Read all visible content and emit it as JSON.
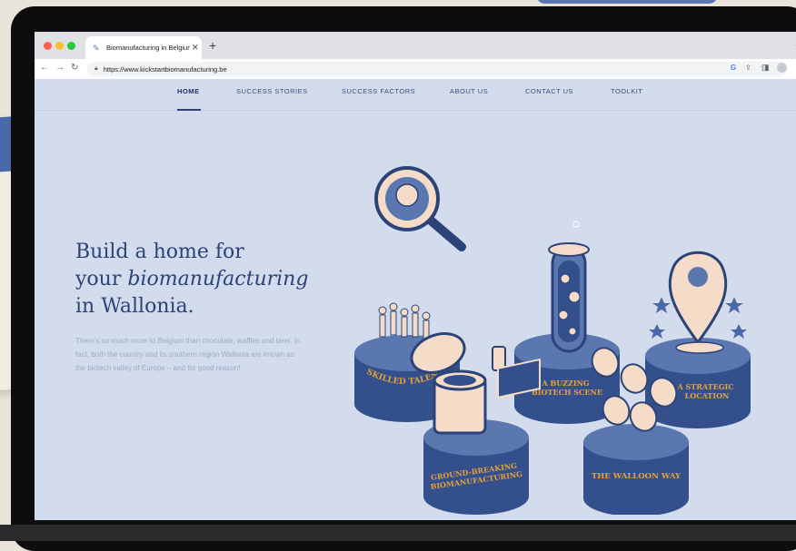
{
  "browser": {
    "tab_title": "Biomanufacturing in Belgium",
    "url": "https://www.kickstartbiomanufacturing.be"
  },
  "nav": {
    "items": [
      {
        "label": "HOME",
        "active": true
      },
      {
        "label": "SUCCESS STORIES",
        "active": false
      },
      {
        "label": "SUCCESS FACTORS",
        "active": false
      },
      {
        "label": "ABOUT US",
        "active": false
      },
      {
        "label": "CONTACT US",
        "active": false
      },
      {
        "label": "TOOLKIT",
        "active": false
      }
    ]
  },
  "hero": {
    "title_line1": "Build a home for",
    "title_line2_plain": "your ",
    "title_line2_em": "biomanufacturing",
    "title_line3": "in Wallonia.",
    "body": "There's so much more to Belgium than chocolate, waffles and beer. In fact, both the country and its southern region Wallonia are known as the biotech valley of Europe – and for good reason!"
  },
  "pillars": [
    {
      "label_line1": "SKILLED TALENT",
      "label_line2": ""
    },
    {
      "label_line1": "A BUZZING",
      "label_line2": "BIOTECH SCENE"
    },
    {
      "label_line1": "A STRATEGIC",
      "label_line2": "LOCATION"
    },
    {
      "label_line1": "GROUND-BREAKING",
      "label_line2": "BIOMANUFACTURING"
    },
    {
      "label_line1": "THE WALLOON WAY",
      "label_line2": ""
    }
  ],
  "colors": {
    "site_bg": "#d3dcec",
    "navy": "#2c4378",
    "pillar_top": "#5a77b0",
    "pillar_side": "#34508c",
    "gold": "#e6a13a",
    "cream": "#f5dcc8"
  }
}
